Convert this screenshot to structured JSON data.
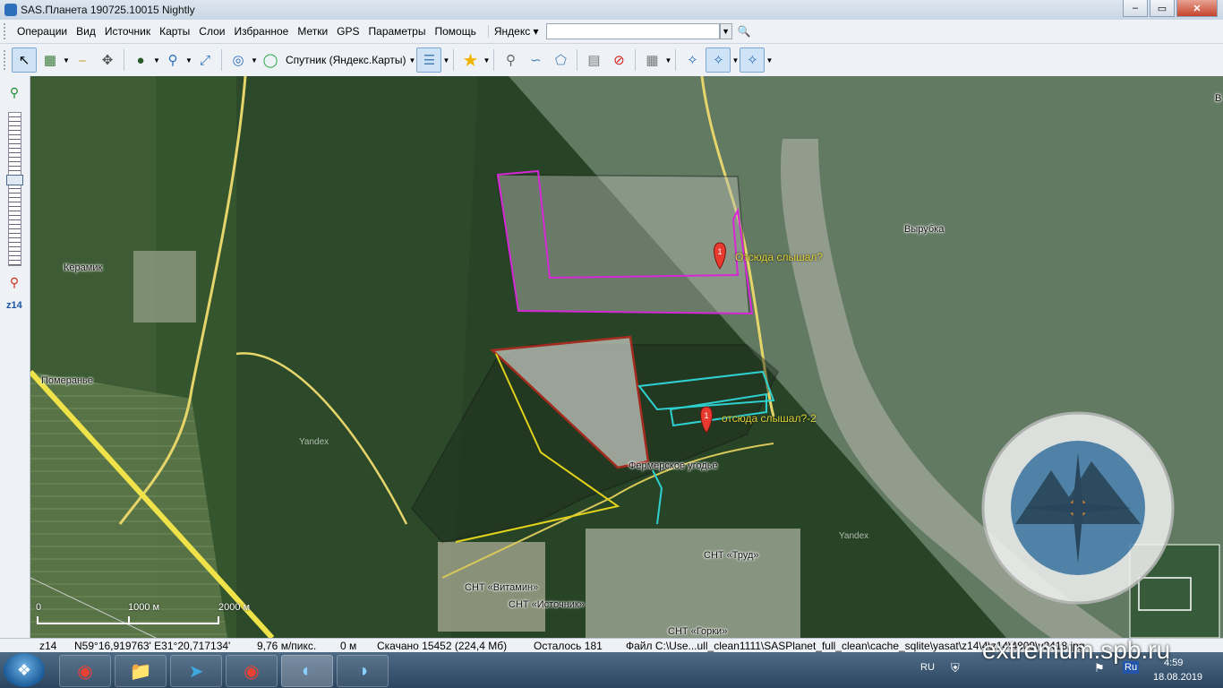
{
  "window": {
    "title": "SAS.Планета 190725.10015 Nightly",
    "minimize": "–",
    "maximize": "▭",
    "close": "✕"
  },
  "menu": {
    "items": [
      "Операции",
      "Вид",
      "Источник",
      "Карты",
      "Слои",
      "Избранное",
      "Метки",
      "GPS",
      "Параметры",
      "Помощь"
    ],
    "search_provider": "Яндекс ▾",
    "search_value": ""
  },
  "toolbar": {
    "map_type": "Спутник (Яндекс.Карты)"
  },
  "zoom_level": "z14",
  "map": {
    "places": {
      "keramik": "Керамик",
      "pomeranye": "Померанье",
      "vyrubka": "Вырубка",
      "fermerskoe": "Фермерское угодье",
      "snt_trud": "СНТ «Труд»",
      "snt_vitamin": "СНТ «Витамин»",
      "snt_istochnik": "СНТ «Источник»",
      "snt_gorki": "СНТ «Горки»",
      "top_edge": "В"
    },
    "markers": [
      {
        "label": "Отсюда слышал?",
        "number": "1"
      },
      {
        "label": "отсюда слышал?-2",
        "number": "1"
      }
    ],
    "watermark": "Yandex",
    "scale": {
      "zero": "0",
      "mid": "1000 м",
      "end": "2000 м"
    },
    "logo_text": "ПОИСКОВО-СПАСАТЕЛЬНЫЙ ОТРЯД ЭКСТРЕМУМ"
  },
  "status": {
    "zoom": "z14",
    "coords": "N59°16,919763' E31°20,717134'",
    "resolution": "9,76 м/пикс.",
    "distance": "0 м",
    "downloaded": "Скачано 15452 (224,4 Мб)",
    "remaining": "Осталось 181",
    "file": "Файл C:\\Use...ull_clean1111\\SASPlanet_full_clean\\cache_sqlite\\yasat\\z14\\4\\z14\\4809\\y2418.jpg"
  },
  "taskbar": {
    "lang": "RU",
    "time": "4:59",
    "date": "18.08.2019",
    "website": "extremum.spb.ru"
  }
}
